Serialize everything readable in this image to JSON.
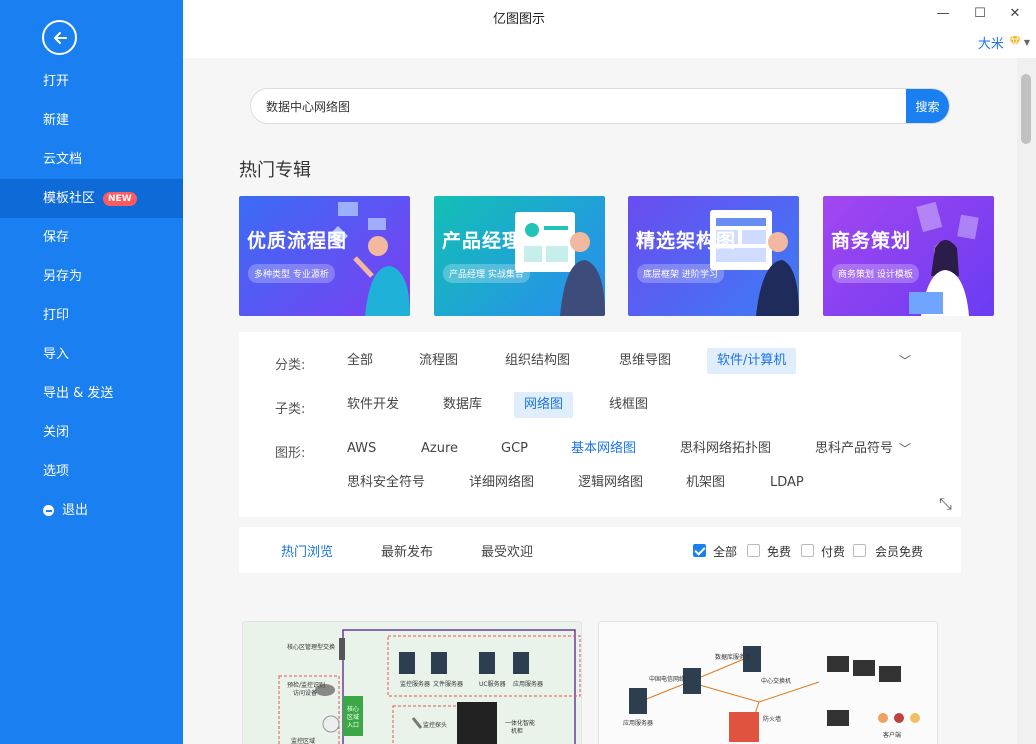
{
  "window": {
    "title": "亿图图示",
    "min_glyph": "—",
    "max_glyph": "☐",
    "close_glyph": "✕"
  },
  "user": {
    "name": "大米",
    "diamond": "♡",
    "caret": "▼"
  },
  "sidebar": {
    "items": [
      {
        "label": "打开"
      },
      {
        "label": "新建"
      },
      {
        "label": "云文档"
      },
      {
        "label": "模板社区",
        "badge": "NEW"
      },
      {
        "label": "保存"
      },
      {
        "label": "另存为"
      },
      {
        "label": "打印"
      },
      {
        "label": "导入"
      },
      {
        "label": "导出 & 发送"
      },
      {
        "label": "关闭"
      },
      {
        "label": "选项"
      },
      {
        "label": "退出"
      }
    ]
  },
  "search": {
    "value": "数据中心网络图",
    "button": "搜索"
  },
  "hot": {
    "title": "热门专辑",
    "banners": [
      {
        "title": "优质流程图",
        "sub": "多种类型 专业源析"
      },
      {
        "title": "产品经理",
        "sub": "产品经理 实战集合"
      },
      {
        "title": "精选架构图",
        "sub": "底层框架 进阶学习"
      },
      {
        "title": "商务策划",
        "sub": "商务策划 设计模板"
      }
    ]
  },
  "filters": {
    "category_label": "分类:",
    "categories": [
      "全部",
      "流程图",
      "组织结构图",
      "思维导图",
      "软件/计算机"
    ],
    "subcategory_label": "子类:",
    "subcategories": [
      "软件开发",
      "数据库",
      "网络图",
      "线框图"
    ],
    "shape_label": "图形:",
    "shapes_row1": [
      "AWS",
      "Azure",
      "GCP",
      "基本网络图",
      "思科网络拓扑图",
      "思科产品符号"
    ],
    "shapes_row2": [
      "思科安全符号",
      "详细网络图",
      "逻辑网络图",
      "机架图",
      "LDAP"
    ],
    "chevron": "﹀",
    "expand_glyph": "⤡"
  },
  "tabs": {
    "items": [
      "热门浏览",
      "最新发布",
      "最受欢迎"
    ],
    "checks": [
      {
        "label": "全部",
        "checked": true
      },
      {
        "label": "免费",
        "checked": false
      },
      {
        "label": "付费",
        "checked": false
      },
      {
        "label": "会员免费",
        "checked": false
      }
    ]
  },
  "cards": {
    "card1": {
      "labels": [
        "核心区管理型交换",
        "监控服务器",
        "文件服务器",
        "UC服务器",
        "应用服务器",
        "预检/监控识别",
        "访问设备",
        "核心",
        "区域",
        "入口",
        "监控探头",
        "监控区域",
        "一体化智能",
        "机柜"
      ]
    },
    "card2": {
      "labels": [
        "中国电信网络",
        "数据库服务器",
        "中心交换机",
        "防火墙",
        "客户端",
        "应用服务器"
      ]
    }
  }
}
